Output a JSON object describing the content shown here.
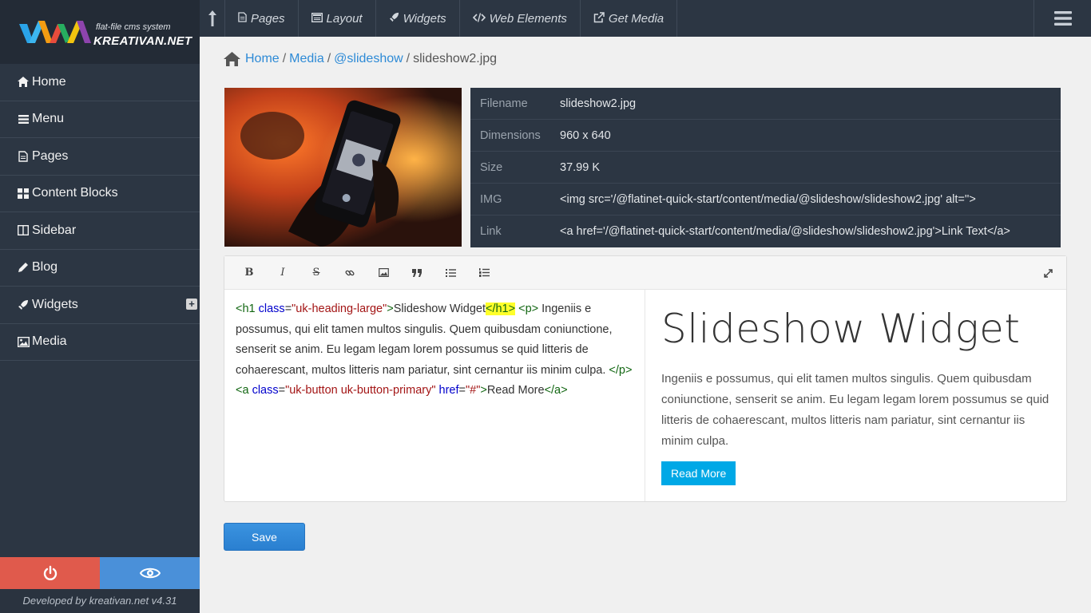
{
  "logo": {
    "subtitle": "flat-file cms system",
    "title": "KREATIVAN.NET"
  },
  "sidebar": {
    "items": [
      {
        "label": "Home",
        "icon": "home-icon"
      },
      {
        "label": "Menu",
        "icon": "bars-icon"
      },
      {
        "label": "Pages",
        "icon": "file-icon"
      },
      {
        "label": "Content Blocks",
        "icon": "grid-icon"
      },
      {
        "label": "Sidebar",
        "icon": "columns-icon"
      },
      {
        "label": "Blog",
        "icon": "pencil-icon"
      },
      {
        "label": "Widgets",
        "icon": "rocket-icon"
      },
      {
        "label": "Media",
        "icon": "image-icon"
      }
    ],
    "power_color": "#e05a4c",
    "preview_color": "#4a90d9",
    "footer": "Developed by kreativan.net v4.31"
  },
  "topbar": {
    "items": [
      {
        "label": "Pages",
        "icon": "file-icon"
      },
      {
        "label": "Layout",
        "icon": "layout-icon"
      },
      {
        "label": "Widgets",
        "icon": "rocket-icon"
      },
      {
        "label": "Web Elements",
        "icon": "code-icon"
      },
      {
        "label": "Get Media",
        "icon": "external-link-icon"
      }
    ]
  },
  "breadcrumb": {
    "home": "Home",
    "media": "Media",
    "folder": "@slideshow",
    "current": "slideshow2.jpg",
    "sep": "/"
  },
  "file_info": {
    "rows": [
      {
        "key": "Filename",
        "value": "slideshow2.jpg"
      },
      {
        "key": "Dimensions",
        "value": "960 x 640"
      },
      {
        "key": "Size",
        "value": "37.99 K"
      },
      {
        "key": "IMG",
        "value": "<img src='/@flatinet-quick-start/content/media/@slideshow/slideshow2.jpg' alt=''>"
      },
      {
        "key": "Link",
        "value": "<a href='/@flatinet-quick-start/content/media/@slideshow/slideshow2.jpg'>Link Text</a>"
      }
    ]
  },
  "editor": {
    "code": {
      "h1_open": "<h1",
      "class_attr": "class",
      "h1_class_val": "\"uk-heading-large\"",
      "gt": ">",
      "h1_text": "Slideshow Widget",
      "h1_close": "</h1>",
      "p_open": "<p>",
      "p_text": " Ingeniis e possumus, qui elit tamen multos singulis. Quem quibusdam   coniunctione, senserit se anim. Eu legam legam lorem possumus se quid litteris   de cohaerescant, multos litteris nam pariatur, sint cernantur iis minim culpa.",
      "p_close": "</p>",
      "a_open": "<a",
      "a_class_val": "\"uk-button uk-button-primary\"",
      "href_attr": "href",
      "href_val": "\"#\"",
      "a_text": "Read More",
      "a_close": "</a>",
      "eq": "="
    },
    "preview": {
      "heading": "Slideshow Widget",
      "paragraph": "Ingeniis e possumus, qui elit tamen multos singulis. Quem quibusdam coniunctione, senserit se anim. Eu legam legam lorem possumus se quid litteris de cohaerescant, multos litteris nam pariatur, sint cernantur iis minim culpa.",
      "button": "Read More",
      "button_color": "#00a8e6"
    }
  },
  "save_label": "Save"
}
